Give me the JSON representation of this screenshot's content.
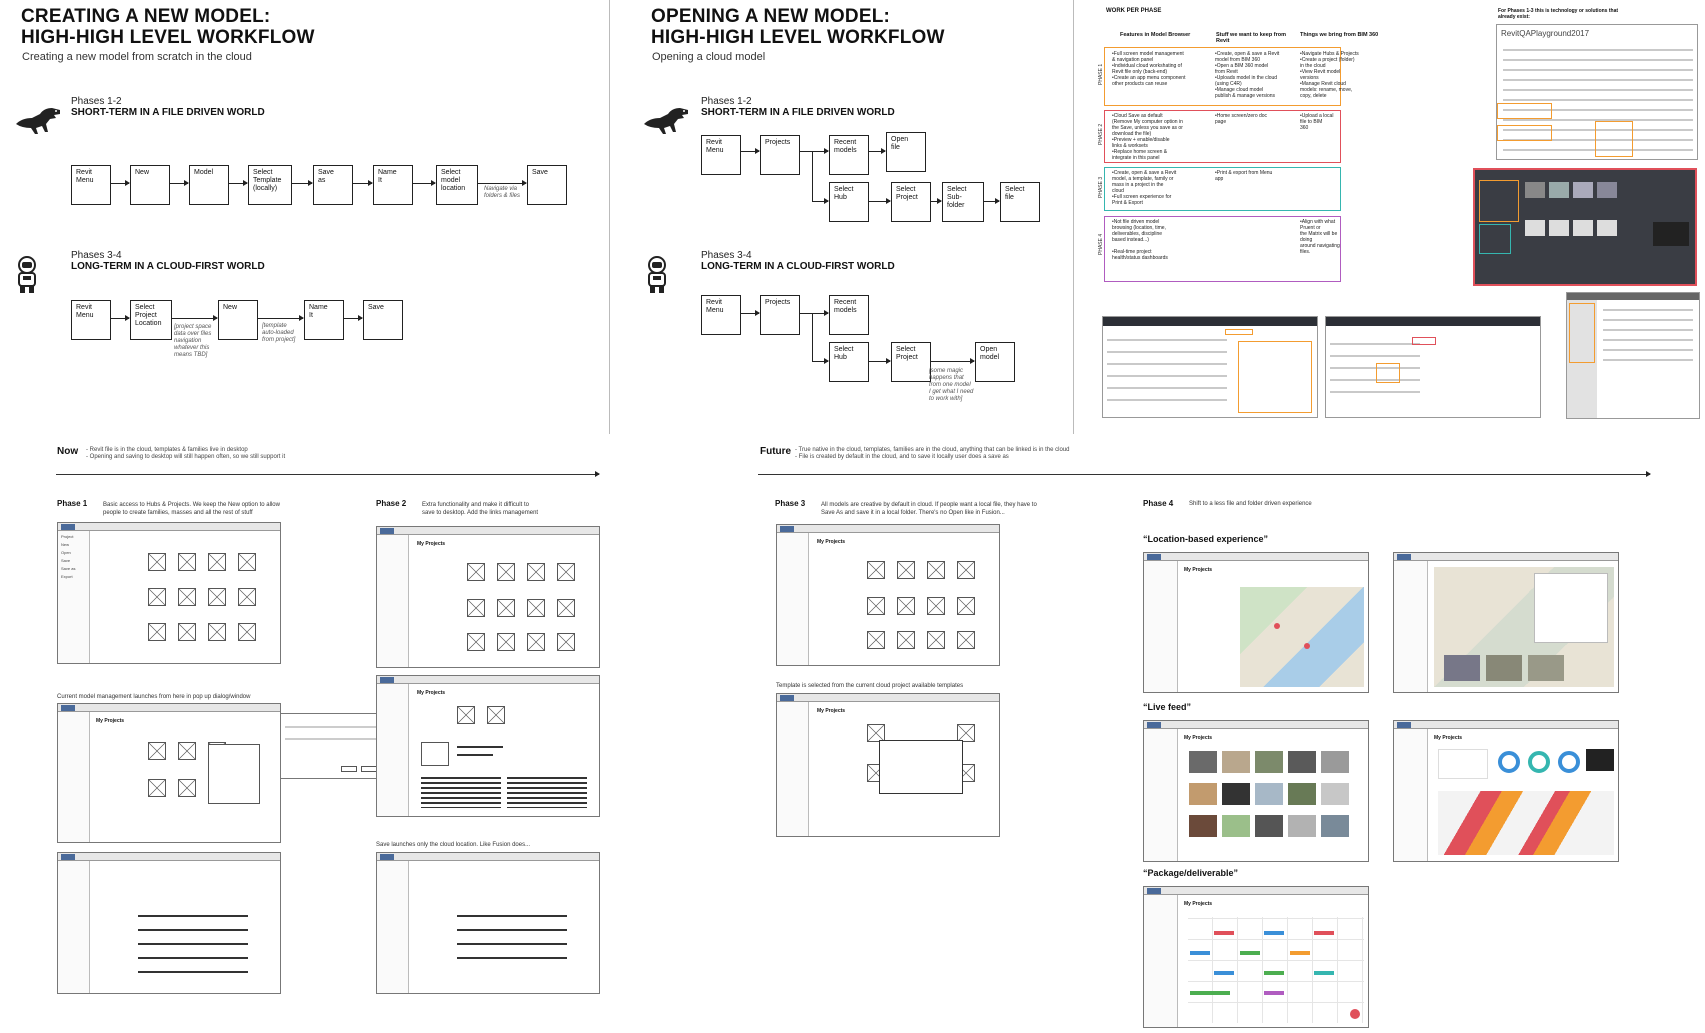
{
  "left_panel": {
    "title": "CREATING A NEW MODEL:\nHIGH-HIGH LEVEL WORKFLOW",
    "subtitle": "Creating a new model from scratch in the cloud",
    "short_term": {
      "phases": "Phases 1-2",
      "heading": "SHORT-TERM IN A FILE DRIVEN WORLD",
      "steps": [
        "Revit\nMenu",
        "New",
        "Model",
        "Select\nTemplate\n(locally)",
        "Save\nas",
        "Name\nIt",
        "Select\nmodel\nlocation",
        "Save"
      ],
      "note": "Navigate via\nfolders & files"
    },
    "long_term": {
      "phases": "Phases 3-4",
      "heading": "LONG-TERM IN A CLOUD-FIRST WORLD",
      "steps": [
        "Revit\nMenu",
        "Select\nProject\nLocation",
        "New",
        "Name\nIt",
        "Save"
      ],
      "note1": "[project space\ndata over files\nnavigation\nwhatever this\nmeans TBD]",
      "note2": "[template\nauto-loaded\nfrom project]"
    }
  },
  "middle_panel": {
    "title": "OPENING A NEW MODEL:\nHIGH-HIGH LEVEL WORKFLOW",
    "subtitle": "Opening a cloud model",
    "short_term": {
      "phases": "Phases 1-2",
      "heading": "SHORT-TERM IN A FILE DRIVEN WORLD",
      "steps": [
        "Revit\nMenu",
        "Projects",
        "Recent\nmodels",
        "Open\nfile",
        "Select\nHub",
        "Select\nProject",
        "Select\nSub-folder",
        "Select\nfile"
      ]
    },
    "long_term": {
      "phases": "Phases 3-4",
      "heading": "LONG-TERM IN A CLOUD-FIRST WORLD",
      "steps": [
        "Revit\nMenu",
        "Projects",
        "Recent\nmodels",
        "Select\nHub",
        "Select\nProject",
        "Open\nmodel"
      ],
      "note": "[some magic\nhappens that\nfrom one model\nI get what I need\nto work with]"
    }
  },
  "work_per_phase": {
    "title": "WORK PER PHASE",
    "columns": [
      "Features in Model Browser",
      "Stuff we want to keep from\nRevit",
      "Things we bring from BIM 360"
    ],
    "rows": [
      {
        "phase": "PHASE 1",
        "color": "#f39c30",
        "cells": [
          "•Full screen model management\n& navigation panel\n•Individual cloud workshating of\nRevit file only (back-end)\n•Create an app menu component\nother products can reuse",
          "•Create, open & save a Revit\nmodel from BIM 360\n•Open a BIM 360 model\nfrom Revit\n•Uploads model in the cloud\n(using C4R)\n•Manage cloud model\npublish & manage versions",
          "•Navigate Hubs & Projects\n•Create a project (folder)\nin the cloud\n•View Revit model\nversions\n•Manage Revit cloud\nmodels: rename, move,\ncopy, delete"
        ]
      },
      {
        "phase": "PHASE 2",
        "color": "#e0505a",
        "cells": [
          "•Cloud Save as default\n(Remove My computer option in\nthe Save, unless you save as or\ndownload the file)\n•Preview + enable/disable\nlinks & worksets\n•Replace home screen &\nintegrate in this panel",
          "•Home screen/zero doc\npage",
          "•Upload a local file to BIM\n360"
        ]
      },
      {
        "phase": "PHASE 3",
        "color": "#35b6b0",
        "cells": [
          "•Create, open & save a Revit\nmodel, a template, family or\nmass in a project in the\ncloud\n•Full screen experience for\nPrint & Export",
          "•Print & export from Menu\napp",
          ""
        ]
      },
      {
        "phase": "PHASE 4",
        "color": "#b05cc0",
        "cells": [
          "•Not file driven model\nbrowsing (location, time,\ndeliverables, discipline\nbased instead...)\n\n•Real-time project\nhealth/status dashboards",
          "",
          "•Align with what Pruent or\nthe Matrix will be doing\naround navigating files."
        ]
      }
    ]
  },
  "existing_solutions": {
    "heading": "For Phases 1-3 this is technology or solutions that\nalready exist:",
    "sub": "RevitQAPlayground2017"
  },
  "timeline": {
    "now_word": "Now",
    "now_note": "- Revit file is in the cloud, templates & families live in desktop\n- Opening and saving to desktop will still happen often, so we still support it",
    "future_word": "Future",
    "future_note": "- True native in the cloud, templates, families are in the cloud, anything that can be linked is in the cloud\n- File is created by default in the cloud, and to save it locally user does a save as"
  },
  "phases": {
    "p1_label": "Phase 1",
    "p1_desc": "Basic access to Hubs & Projects. We keep the New option to allow\npeople to create families, masses and all the rest of stuff",
    "p1_cap2": "Current model management launches from here in pop up dialog/window",
    "p2_label": "Phase 2",
    "p2_desc": "Extra functionality and make it difficult to\nsave to desktop. Add the links management",
    "p2_cap3": "Save launches only the cloud location. Like Fusion does...",
    "p3_label": "Phase 3",
    "p3_desc": "All models are creative by default in cloud. If people want a local file, they have to\nSave As and save it in a local folder. There's no Open like in Fusion...",
    "p3_cap2": "Template is selected from the current cloud project available templates",
    "p4_label": "Phase 4",
    "p4_desc": "Shift to a less file and folder driven experience",
    "q1": "“Location-based experience”",
    "q2": "“Live feed”",
    "q3": "“Package/deliverable”",
    "wf_header": "My Projects",
    "wf_side": [
      "Project",
      "New",
      "Open",
      "Save",
      "Save as",
      "Export",
      "Print",
      "Close"
    ]
  },
  "colors": {
    "orange": "#f39c30",
    "red": "#e0505a",
    "teal": "#35b6b0",
    "purple": "#b05cc0",
    "dark": "#2c2f36"
  },
  "icons": [
    "t-rex-icon",
    "astronaut-icon"
  ]
}
